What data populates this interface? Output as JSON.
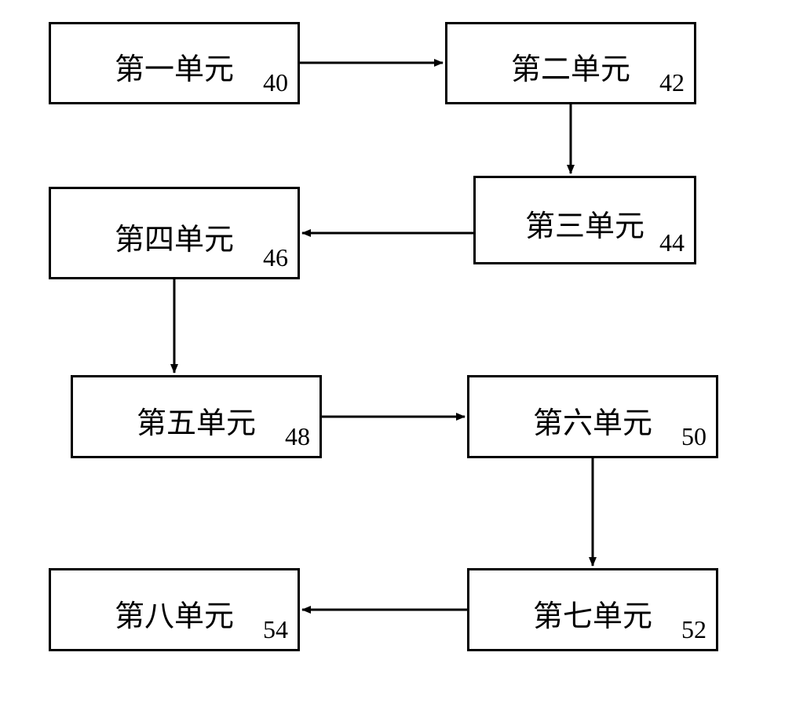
{
  "boxes": {
    "b1": {
      "label": "第一单元",
      "number": "40"
    },
    "b2": {
      "label": "第二单元",
      "number": "42"
    },
    "b3": {
      "label": "第三单元",
      "number": "44"
    },
    "b4": {
      "label": "第四单元",
      "number": "46"
    },
    "b5": {
      "label": "第五单元",
      "number": "48"
    },
    "b6": {
      "label": "第六单元",
      "number": "50"
    },
    "b7": {
      "label": "第七单元",
      "number": "52"
    },
    "b8": {
      "label": "第八单元",
      "number": "54"
    }
  }
}
